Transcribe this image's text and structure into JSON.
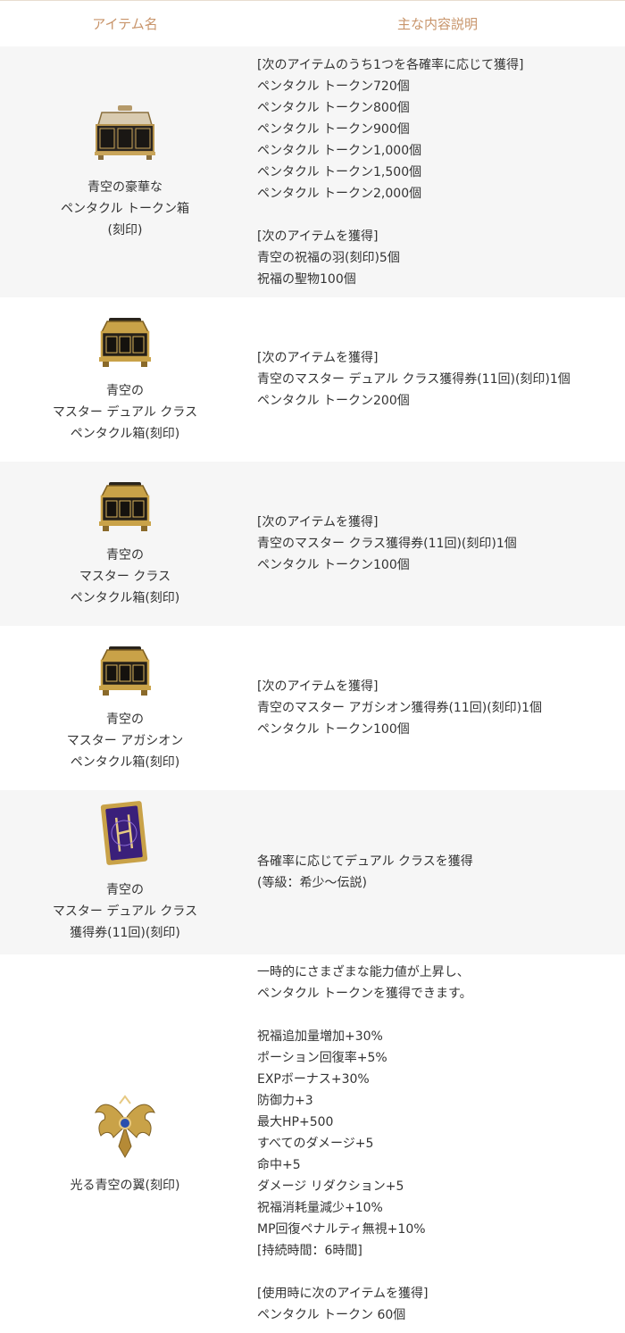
{
  "header": {
    "col1": "アイテム名",
    "col2": "主な内容説明"
  },
  "rows": [
    {
      "name": "青空の豪華な\nペンタクル トークン箱\n(刻印)",
      "desc": "[次のアイテムのうち1つを各確率に応じて獲得]\nペンタクル トークン720個\nペンタクル トークン800個\nペンタクル トークン900個\nペンタクル トークン1,000個\nペンタクル トークン1,500個\nペンタクル トークン2,000個\n\n[次のアイテムを獲得]\n青空の祝福の羽(刻印)5個\n祝福の聖物100個",
      "icon": "luxury-chest-icon"
    },
    {
      "name": "青空の\nマスター デュアル クラス\nペンタクル箱(刻印)",
      "desc": "[次のアイテムを獲得]\n青空のマスター デュアル クラス獲得券(11回)(刻印)1個\nペンタクル トークン200個",
      "icon": "gold-chest-icon"
    },
    {
      "name": "青空の\nマスター クラス\nペンタクル箱(刻印)",
      "desc": "[次のアイテムを獲得]\n青空のマスター クラス獲得券(11回)(刻印)1個\nペンタクル トークン100個",
      "icon": "gold-chest-icon"
    },
    {
      "name": "青空の\nマスター アガシオン\nペンタクル箱(刻印)",
      "desc": "[次のアイテムを獲得]\n青空のマスター アガシオン獲得券(11回)(刻印)1個\nペンタクル トークン100個",
      "icon": "gold-chest-icon"
    },
    {
      "name": "青空の\nマスター デュアル クラス\n獲得券(11回)(刻印)",
      "desc": "各確率に応じてデュアル クラスを獲得\n(等級：希少～伝説)",
      "icon": "purple-card-icon"
    },
    {
      "name": "光る青空の翼(刻印)",
      "desc": "一時的にさまざまな能力値が上昇し、\nペンタクル トークンを獲得できます。\n\n祝福追加量増加+30%\nポーション回復率+5%\nEXPボーナス+30%\n防御力+3\n最大HP+500\nすべてのダメージ+5\n命中+5\nダメージ リダクション+5\n祝福消耗量減少+10%\nMP回復ペナルティ無視+10%\n[持続時間：6時間]\n\n[使用時に次のアイテムを獲得]\nペンタクル トークン 60個",
      "icon": "wings-icon"
    }
  ]
}
